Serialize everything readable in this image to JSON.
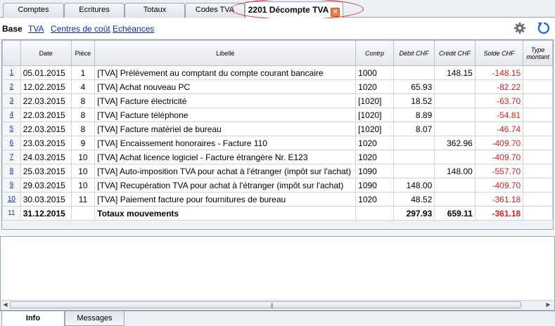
{
  "tabs": [
    {
      "label": "Comptes"
    },
    {
      "label": "Ecritures"
    },
    {
      "label": "Totaux"
    },
    {
      "label": "Codes TVA"
    },
    {
      "label": "2201 Décompte TVA",
      "active": true,
      "closable": true
    }
  ],
  "subbar": {
    "base_label": "Base",
    "links": [
      "TVA",
      "Centres de coût",
      "Echéances"
    ]
  },
  "icons": {
    "settings": "gear-icon",
    "refresh": "refresh-icon",
    "close": "close-icon"
  },
  "colors": {
    "negative": "#d91e1e",
    "link": "#0a2fb4",
    "close_button": "#f07a4a"
  },
  "table": {
    "columns": [
      "Date",
      "Pièce",
      "Libellé",
      "Contrp",
      "Débit CHF",
      "Crédit CHF",
      "Solde CHF",
      "Type montant"
    ],
    "rows": [
      {
        "n": "1",
        "date": "05.01.2015",
        "piece": "1",
        "libelle": "[TVA] Prélèvement au comptant du compte courant bancaire",
        "contrp": "1000",
        "debit": "",
        "credit": "148.15",
        "solde": "-148.15",
        "type": ""
      },
      {
        "n": "2",
        "date": "12.02.2015",
        "piece": "4",
        "libelle": "[TVA] Achat nouveau PC",
        "contrp": "1020",
        "debit": "65.93",
        "credit": "",
        "solde": "-82.22",
        "type": ""
      },
      {
        "n": "3",
        "date": "22.03.2015",
        "piece": "8",
        "libelle": "[TVA] Facture électricité",
        "contrp": "[1020]",
        "debit": "18.52",
        "credit": "",
        "solde": "-63.70",
        "type": ""
      },
      {
        "n": "4",
        "date": "22.03.2015",
        "piece": "8",
        "libelle": "[TVA] Facture téléphone",
        "contrp": "[1020]",
        "debit": "8.89",
        "credit": "",
        "solde": "-54.81",
        "type": ""
      },
      {
        "n": "5",
        "date": "22.03.2015",
        "piece": "8",
        "libelle": "[TVA] Facture matériel de bureau",
        "contrp": "[1020]",
        "debit": "8.07",
        "credit": "",
        "solde": "-46.74",
        "type": ""
      },
      {
        "n": "6",
        "date": "23.03.2015",
        "piece": "9",
        "libelle": "[TVA] Encaissement honoraires - Facture 110",
        "contrp": "1020",
        "debit": "",
        "credit": "362.96",
        "solde": "-409.70",
        "type": ""
      },
      {
        "n": "7",
        "date": "24.03.2015",
        "piece": "10",
        "libelle": "[TVA] Achat licence logiciel - Facture étrangère Nr. E123",
        "contrp": "1020",
        "debit": "",
        "credit": "",
        "solde": "-409.70",
        "type": ""
      },
      {
        "n": "8",
        "date": "25.03.2015",
        "piece": "10",
        "libelle": "[TVA] Auto-imposition TVA pour achat à l'étranger (impôt sur l'achat)",
        "contrp": "1090",
        "debit": "",
        "credit": "148.00",
        "solde": "-557.70",
        "type": ""
      },
      {
        "n": "9",
        "date": "29.03.2015",
        "piece": "10",
        "libelle": "[TVA] Recupération TVA pour achat à l'étranger (impôt sur l'achat)",
        "contrp": "1090",
        "debit": "148.00",
        "credit": "",
        "solde": "-409.70",
        "type": ""
      },
      {
        "n": "10",
        "date": "30.03.2015",
        "piece": "11",
        "libelle": "[TVA] Paiement facture pour fournitures de bureau",
        "contrp": "1020",
        "debit": "48.52",
        "credit": "",
        "solde": "-361.18",
        "type": ""
      }
    ],
    "total": {
      "n": "11",
      "date": "31.12.2015",
      "piece": "",
      "libelle": "Totaux mouvements",
      "contrp": "",
      "debit": "297.93",
      "credit": "659.11",
      "solde": "-361.18",
      "type": ""
    }
  },
  "bottom_tabs": [
    {
      "label": "Info",
      "active": true
    },
    {
      "label": "Messages"
    }
  ]
}
